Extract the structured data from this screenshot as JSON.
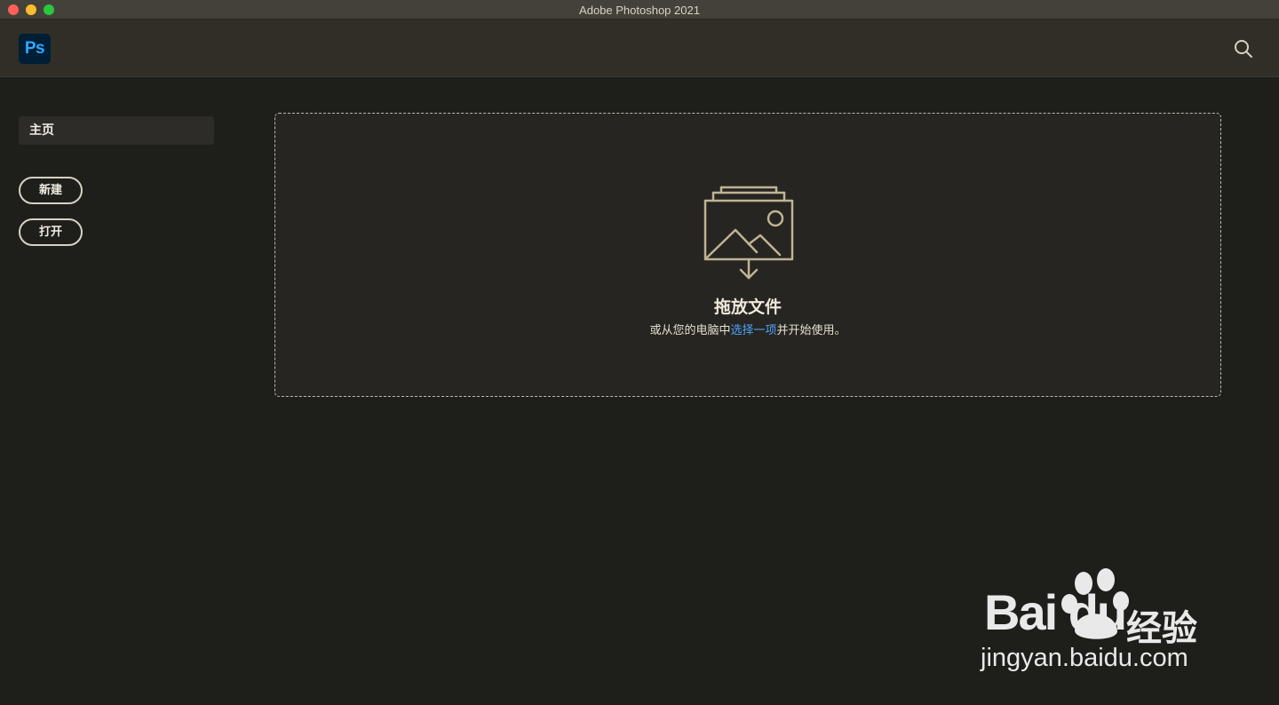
{
  "window": {
    "title": "Adobe Photoshop 2021"
  },
  "appbar": {
    "logo_text": "Ps",
    "search_icon": "search-icon"
  },
  "sidebar": {
    "home_label": "主页",
    "new_label": "新建",
    "open_label": "打开"
  },
  "dropzone": {
    "icon": "image-download-icon",
    "title": "拖放文件",
    "subtitle_prefix": "或从您的电脑中",
    "subtitle_link": "选择一项",
    "subtitle_suffix": "并开始使用。"
  },
  "watermark": {
    "brand": "Bai du",
    "cn": "经验",
    "url": "jingyan.baidu.com"
  },
  "colors": {
    "background": "#1e1e1b",
    "appbar": "#312e28",
    "link": "#4da3ff",
    "ps_logo_bg": "#001e36",
    "ps_logo_fg": "#31a8ff"
  }
}
